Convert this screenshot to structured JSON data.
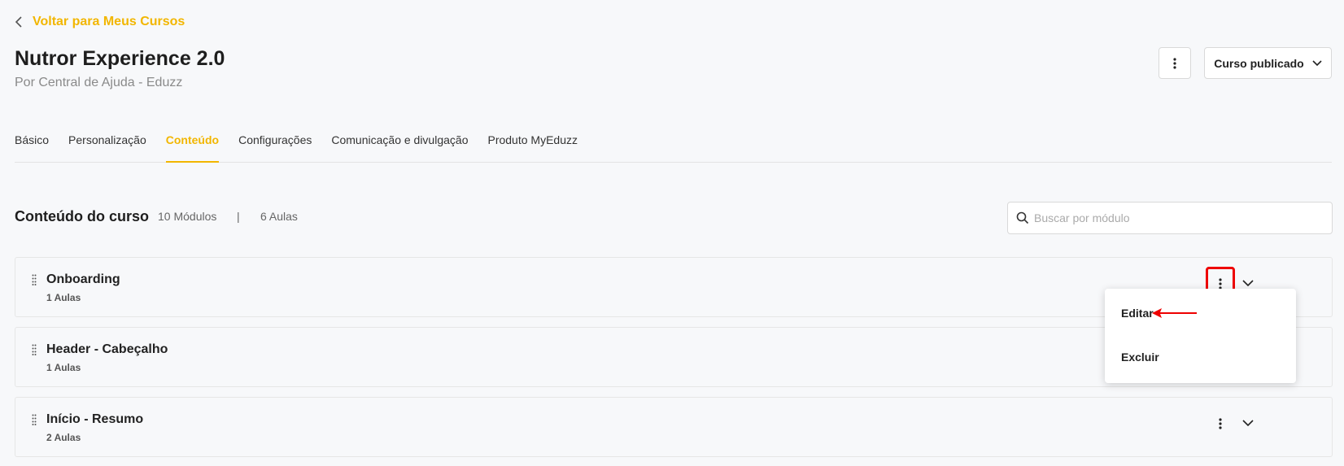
{
  "header": {
    "back_label": "Voltar para Meus Cursos",
    "title": "Nutror Experience 2.0",
    "subtitle": "Por Central de Ajuda - Eduzz",
    "status_label": "Curso publicado"
  },
  "tabs": [
    {
      "label": "Básico",
      "active": false
    },
    {
      "label": "Personalização",
      "active": false
    },
    {
      "label": "Conteúdo",
      "active": true
    },
    {
      "label": "Configurações",
      "active": false
    },
    {
      "label": "Comunicação e divulgação",
      "active": false
    },
    {
      "label": "Produto MyEduzz",
      "active": false
    }
  ],
  "content": {
    "title": "Conteúdo do curso",
    "modules_count": "10 Módulos",
    "separator": "|",
    "lessons_count": "6 Aulas",
    "search_placeholder": "Buscar por módulo"
  },
  "modules": [
    {
      "name": "Onboarding",
      "lessons": "1 Aulas"
    },
    {
      "name": "Header - Cabeçalho",
      "lessons": "1 Aulas"
    },
    {
      "name": "Início - Resumo",
      "lessons": "2 Aulas"
    }
  ],
  "menu": {
    "edit_label": "Editar",
    "delete_label": "Excluir"
  },
  "colors": {
    "accent": "#f2b600",
    "annotation": "#e00000"
  }
}
